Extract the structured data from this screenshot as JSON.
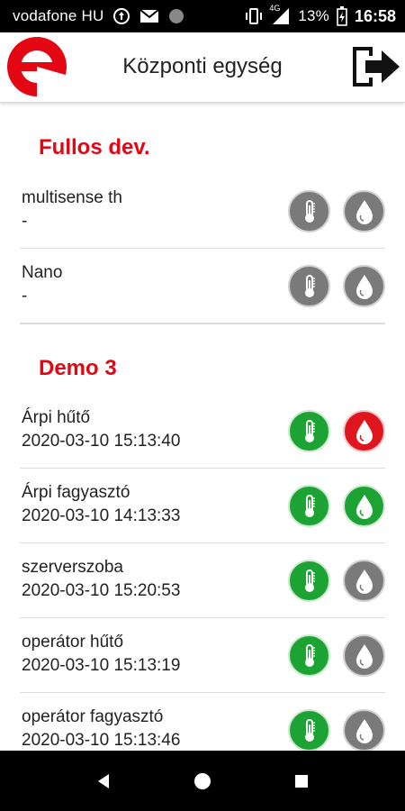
{
  "status_bar": {
    "carrier": "vodafone HU",
    "network": "4G",
    "battery": "13%",
    "time": "16:58"
  },
  "app_bar": {
    "title": "Központi egység",
    "logo_icon": "e-logo",
    "logout_icon": "logout-icon"
  },
  "sections": [
    {
      "title": "Fullos dev.",
      "devices": [
        {
          "name": "multisense th",
          "time": "-",
          "temp_status": "grey",
          "humidity_status": "grey"
        },
        {
          "name": "Nano",
          "time": "-",
          "temp_status": "grey",
          "humidity_status": "grey"
        }
      ]
    },
    {
      "title": "Demo 3",
      "devices": [
        {
          "name": "Árpi hűtő",
          "time": "2020-03-10 15:13:40",
          "temp_status": "green",
          "humidity_status": "red"
        },
        {
          "name": "Árpi fagyasztó",
          "time": "2020-03-10 14:13:33",
          "temp_status": "green",
          "humidity_status": "green"
        },
        {
          "name": "szerverszoba",
          "time": "2020-03-10 15:20:53",
          "temp_status": "green",
          "humidity_status": "grey"
        },
        {
          "name": "operátor hűtő",
          "time": "2020-03-10 15:13:19",
          "temp_status": "green",
          "humidity_status": "grey"
        },
        {
          "name": "operátor fagyasztó",
          "time": "2020-03-10 15:13:46",
          "temp_status": "green",
          "humidity_status": "grey"
        }
      ]
    }
  ],
  "colors": {
    "accent": "#e30613",
    "ok": "#1ca333",
    "alarm": "#e0161f",
    "inactive": "#7a7a7a"
  },
  "nav_bar": {
    "back_icon": "back-triangle-icon",
    "home_icon": "home-circle-icon",
    "recents_icon": "recents-square-icon"
  }
}
